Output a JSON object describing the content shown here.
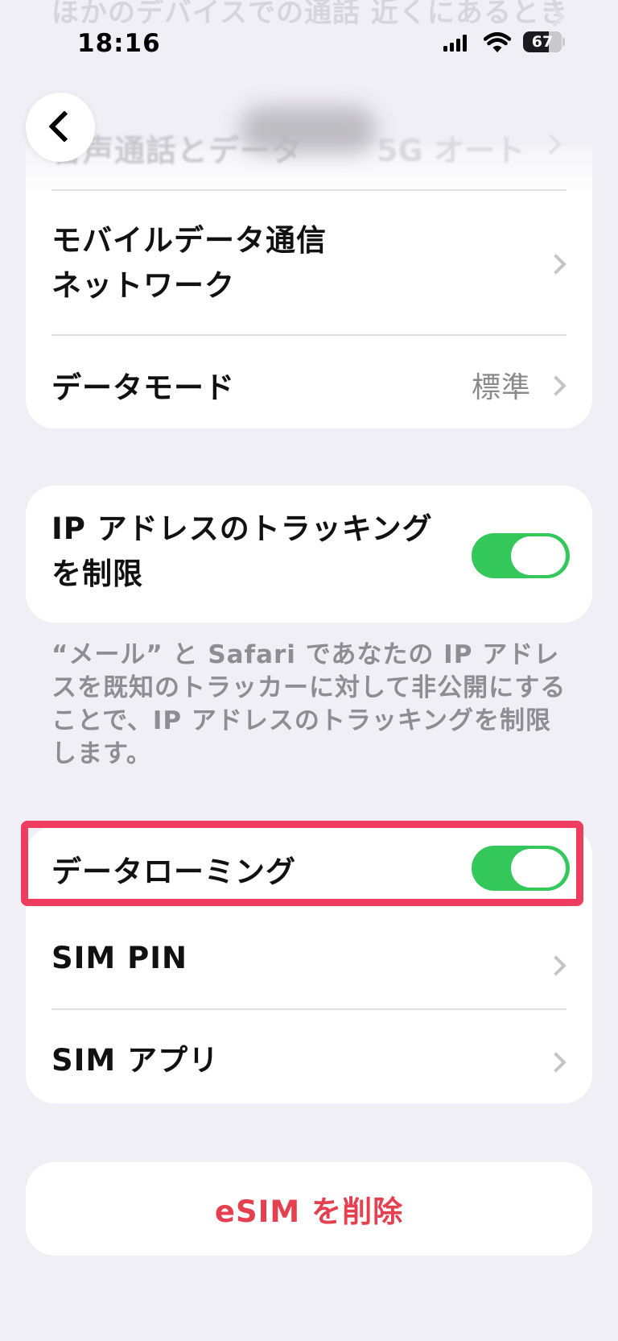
{
  "status_bar": {
    "time": "18:16",
    "battery_percent": "67"
  },
  "background_row": {
    "text": "ほかのデバイスでの通話 近くにあるとき"
  },
  "nav": {
    "blurred_row_label": "音声通話とデータ",
    "blurred_row_value": "5G オート"
  },
  "cellular_section": {
    "mobile_data_network_line1": "モバイルデータ通信",
    "mobile_data_network_line2": "ネットワーク",
    "data_mode_label": "データモード",
    "data_mode_value": "標準"
  },
  "ip_tracking": {
    "label_line1": "IP アドレスのトラッキング",
    "label_line2": "を制限",
    "enabled": true,
    "footnote": "“メール” と Safari であなたの IP アドレスを既知のトラッカーに対して非公開にすることで、IP アドレスのトラッキングを制限します。"
  },
  "sim_section": {
    "data_roaming_label": "データローミング",
    "data_roaming_enabled": true,
    "sim_pin_label": "SIM PIN",
    "sim_apps_label": "SIM アプリ"
  },
  "delete_esim_label": "eSIM を削除",
  "colors": {
    "background": "#f0eff5",
    "toggle_on": "#34c759",
    "destructive": "#e5404e",
    "highlight": "#ee3d5e",
    "secondary_text": "#8a8a8e"
  }
}
